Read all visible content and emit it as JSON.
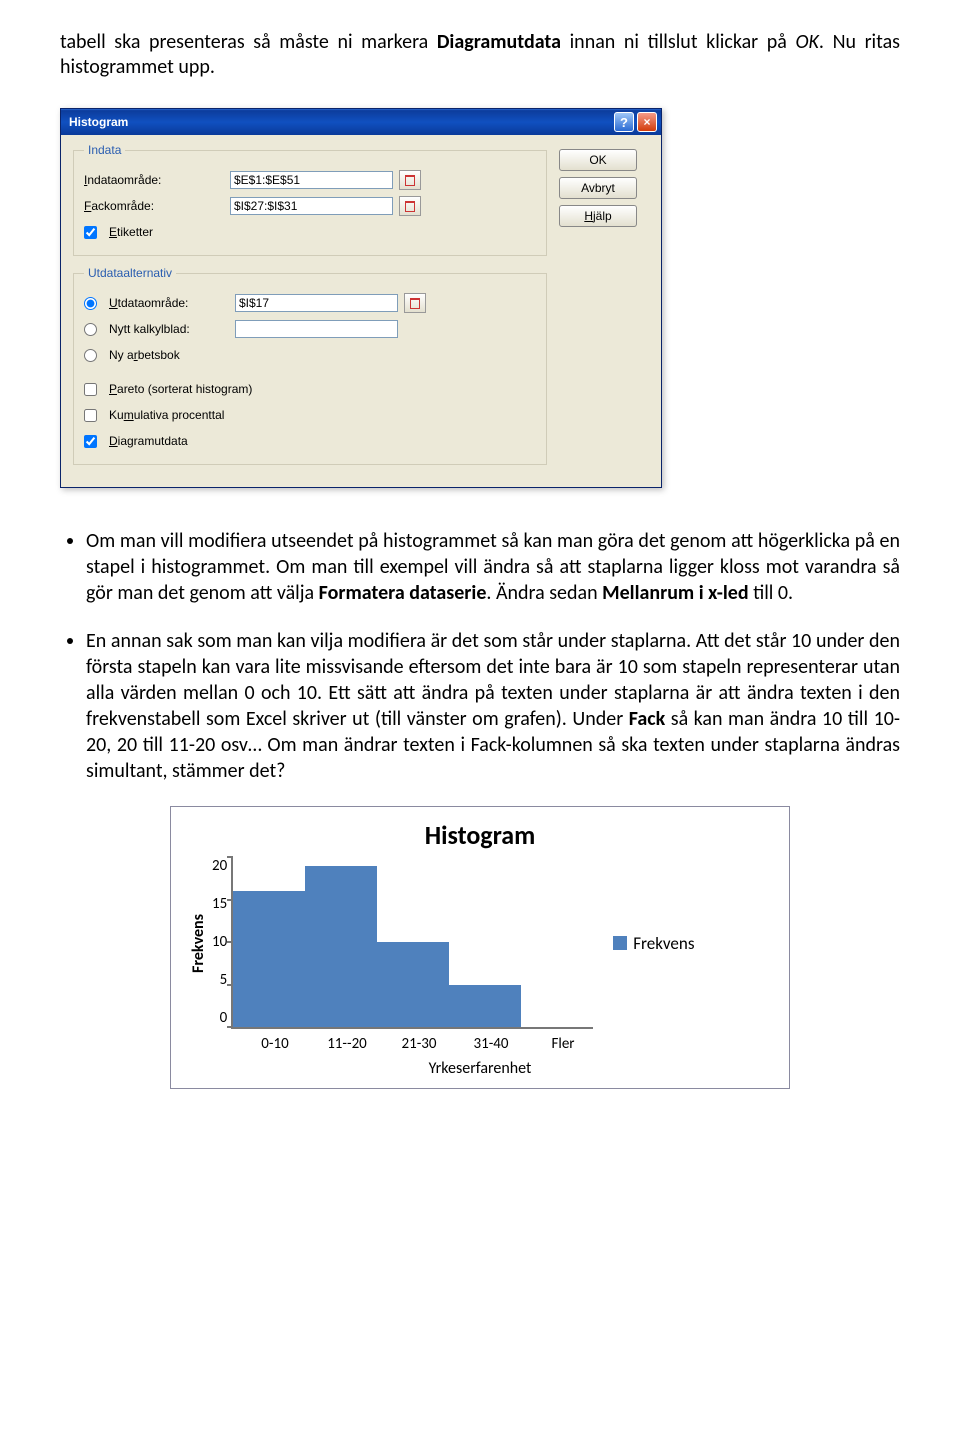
{
  "intro": {
    "line1_pre": "tabell ska presenteras så måste ni markera ",
    "line1_bold": "Diagramutdata",
    "line1_post": " innan ni tillslut klickar på ",
    "line1_italic": "OK",
    "line1_end": ". Nu ritas histogrammet upp."
  },
  "dialog": {
    "title": "Histogram",
    "btn_ok": "OK",
    "btn_cancel": "Avbryt",
    "btn_help": "Hjälp",
    "group_in": "Indata",
    "lbl_indata_u": "I",
    "lbl_indata_rest": "ndataområde:",
    "val_indata": "$E$1:$E$51",
    "lbl_fack_u": "F",
    "lbl_fack_rest": "ackområde:",
    "val_fack": "$I$27:$I$31",
    "lbl_etik_u": "E",
    "lbl_etik_rest": "tiketter",
    "group_out": "Utdataalternativ",
    "lbl_utdata_u": "U",
    "lbl_utdata_rest": "tdataområde:",
    "val_utdata": "$I$17",
    "lbl_nyttkb": "Nytt kalkylblad:",
    "lbl_nyarb_pre": "Ny a",
    "lbl_nyarb_u": "r",
    "lbl_nyarb_post": "betsbok",
    "lbl_pareto_u": "P",
    "lbl_pareto_rest": "areto (sorterat histogram)",
    "lbl_kumul_pre": "Ku",
    "lbl_kumul_u": "m",
    "lbl_kumul_post": "ulativa procenttal",
    "lbl_diag_u": "D",
    "lbl_diag_rest": "iagramutdata"
  },
  "bullet1": {
    "a": "Om man vill modifiera utseendet på histogrammet så kan man göra det genom att högerklicka på en stapel i histogrammet. Om man till exempel vill ändra så att staplarna ligger kloss mot varandra så gör man det genom att välja ",
    "b_bold": "Formatera dataserie",
    "c": ". Ändra sedan ",
    "d_bold": "Mellanrum i x-led",
    "e": " till 0."
  },
  "bullet2": {
    "a": "En annan sak som man kan vilja modifiera är det som står under staplarna. Att det står 10 under den första stapeln kan vara lite missvisande eftersom det inte bara är 10 som stapeln representerar utan alla värden mellan 0 och 10. Ett sätt att ändra på texten under staplarna är att ändra texten i den frekvenstabell som Excel skriver ut (till vänster om grafen). Under ",
    "b_bold": "Fack",
    "c": " så kan man ändra 10 till 10-20, 20 till 11-20 osv… Om man ändrar texten i Fack-kolumnen så ska texten under staplarna ändras simultant, stämmer det?"
  },
  "chart_data": {
    "type": "bar",
    "title": "Histogram",
    "xlabel": "Yrkeserfarenhet",
    "ylabel": "Frekvens",
    "ylim": [
      0,
      20
    ],
    "yticks": [
      0,
      5,
      10,
      15,
      20
    ],
    "categories": [
      "0-10",
      "11--20",
      "21-30",
      "31-40",
      "Fler"
    ],
    "series": [
      {
        "name": "Frekvens",
        "values": [
          16,
          19,
          10,
          5,
          0
        ]
      }
    ],
    "color": "#4f81bd"
  }
}
